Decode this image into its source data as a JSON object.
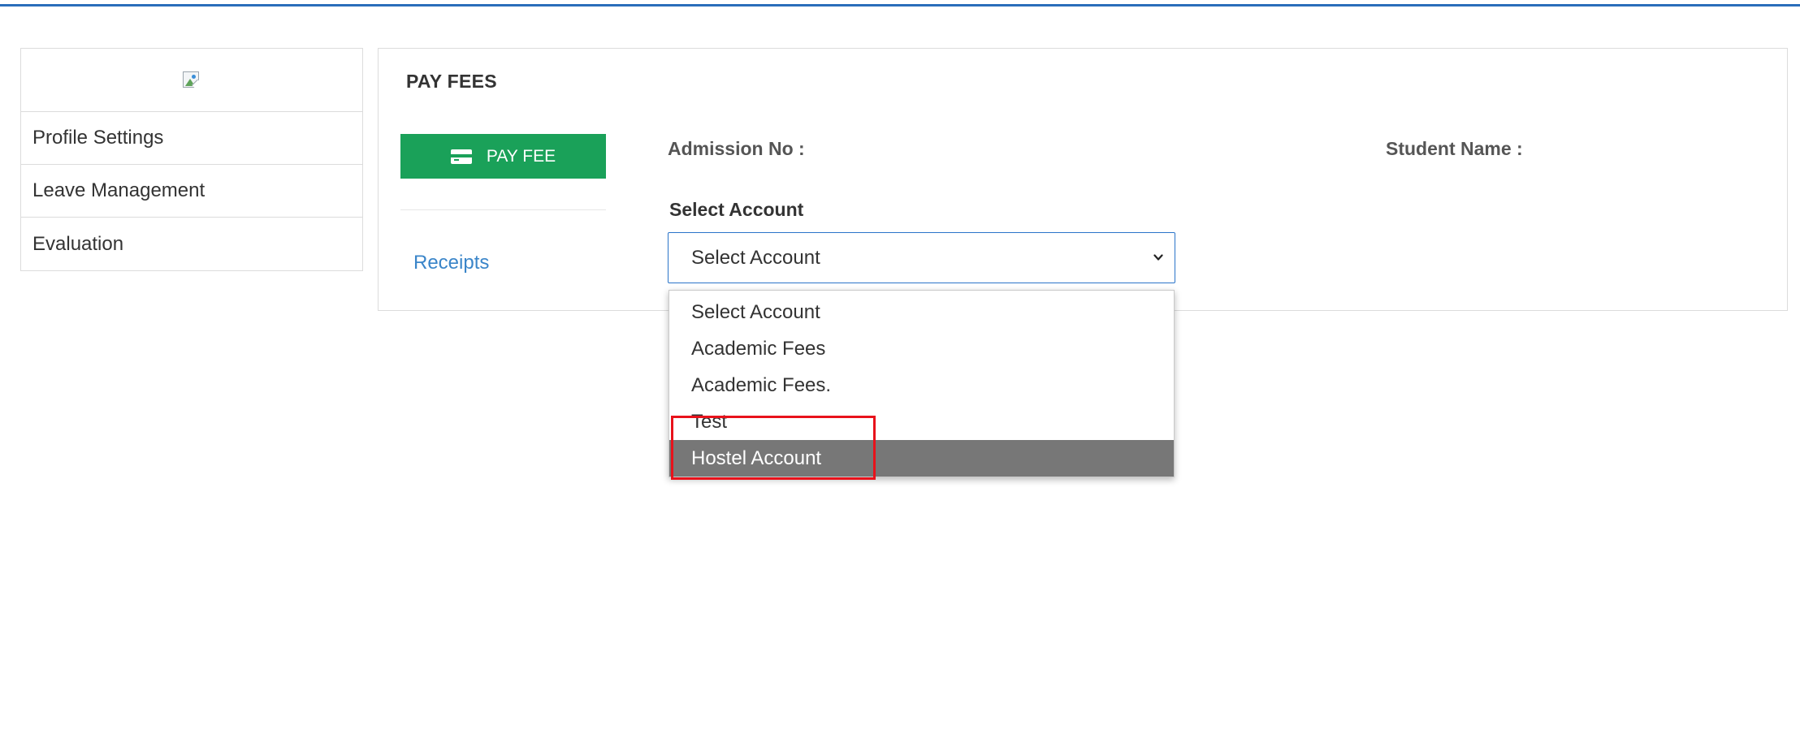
{
  "sidebar": {
    "logo_icon": "broken-image-icon",
    "items": [
      {
        "label": "Profile Settings"
      },
      {
        "label": "Leave Management"
      },
      {
        "label": "Evaluation"
      }
    ]
  },
  "panel": {
    "title": "PAY FEES",
    "pay_fee_button": {
      "label": "PAY FEE",
      "icon": "credit-card-icon",
      "color": "#1aa159"
    },
    "receipts_link": "Receipts",
    "admission_label": "Admission No :",
    "student_name_label": "Student Name :",
    "select_account_label": "Select Account",
    "select": {
      "current_value": "Select Account",
      "options": [
        "Select Account",
        "Academic Fees",
        "Academic Fees.",
        "Test",
        "Hostel Account"
      ],
      "highlighted_option": "Hostel Account"
    }
  },
  "colors": {
    "accent_blue": "#2a6ebb",
    "link_blue": "#3a85c9",
    "highlight_red": "#e8121b",
    "option_highlight": "#777777"
  }
}
